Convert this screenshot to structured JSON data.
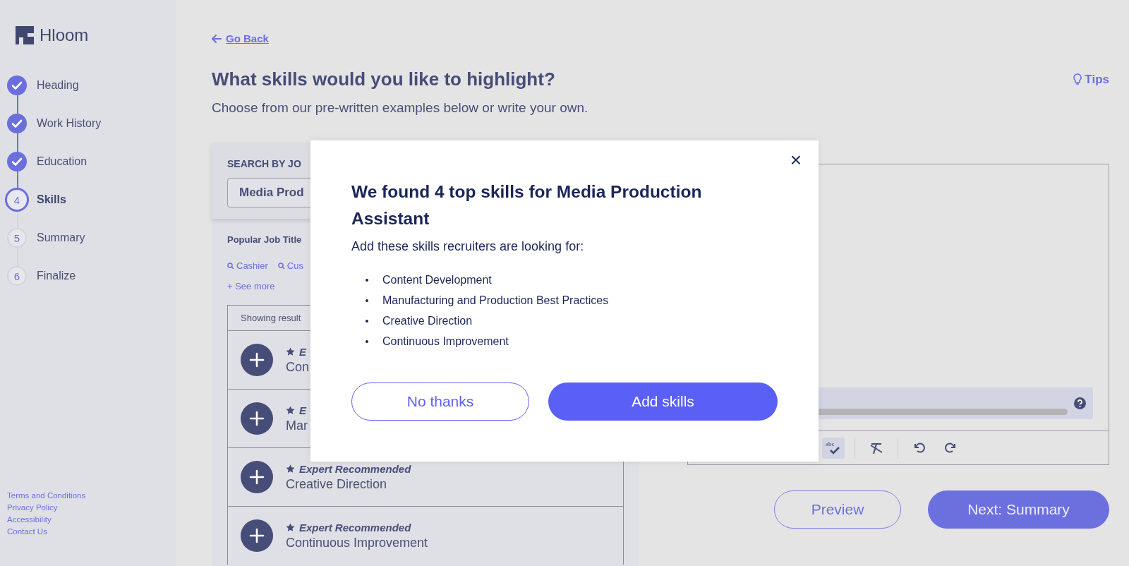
{
  "brand": {
    "name": "Hloom"
  },
  "steps": [
    {
      "label": "Heading",
      "completed": true,
      "selected": false
    },
    {
      "label": "Work History",
      "completed": true,
      "selected": false
    },
    {
      "label": "Education",
      "completed": true,
      "selected": false
    },
    {
      "label": "Skills",
      "number": "4",
      "completed": false,
      "selected": true
    },
    {
      "label": "Summary",
      "number": "5",
      "completed": false,
      "selected": false
    },
    {
      "label": "Finalize",
      "number": "6",
      "completed": false,
      "selected": false
    }
  ],
  "footer_links": [
    "Terms and Conditions",
    "Privacy Policy",
    "Accessibility",
    "Contact Us"
  ],
  "back_link": "Go Back",
  "page_title": "What skills would you like to highlight?",
  "page_subtitle": "Choose from our pre-written examples below or write your own.",
  "tips": "Tips",
  "search_panel": {
    "heading": "SEARCH BY JO",
    "job_title_value": "Media Prod",
    "popular_label": "Popular Job Title",
    "popular_titles": [
      "Cashier",
      "Cus"
    ],
    "see_more": "+ See more",
    "results_header": "Showing result",
    "results": [
      {
        "tag": "E",
        "skill": "Con"
      },
      {
        "tag": "E",
        "skill": "Mar"
      },
      {
        "tag": "Expert Recommended",
        "skill": "Creative Direction"
      },
      {
        "tag": "Expert Recommended",
        "skill": "Continuous Improvement"
      }
    ]
  },
  "editor": {
    "spellcheck_on": true,
    "spellcheck_text": "abc"
  },
  "actions": {
    "preview": "Preview",
    "next": "Next: Summary"
  },
  "modal": {
    "close": "×",
    "title": "We found 4 top skills for Media Production Assistant",
    "subtitle": "Add these skills recruiters are looking for:",
    "skills": [
      "Content Development",
      "Manufacturing and Production Best Practices",
      "Creative Direction",
      "Continuous Improvement"
    ],
    "decline": "No thanks",
    "confirm": "Add skills"
  }
}
